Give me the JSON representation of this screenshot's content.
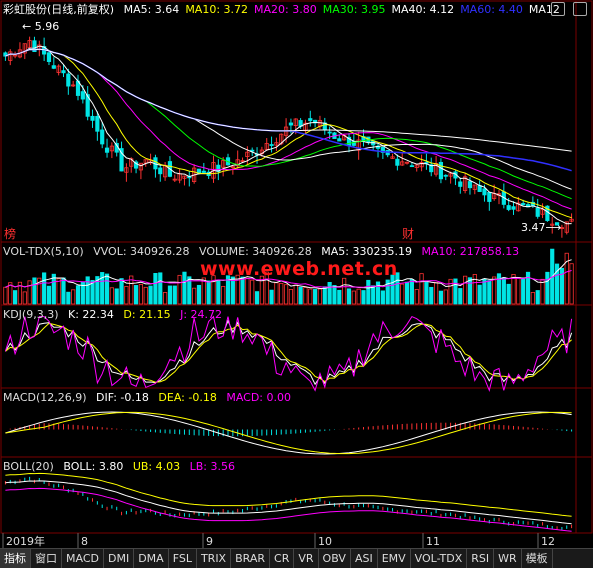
{
  "colors": {
    "bg": "#000000",
    "up": "#ff3232",
    "down": "#00e5e5",
    "grid": "#7a0000",
    "ma5": "#ffffff",
    "ma10": "#ffff00",
    "ma20": "#ff00ff",
    "ma30": "#00ff00",
    "ma40": "#ffffff",
    "ma60": "#3030ff",
    "ma120": "#ffffff"
  },
  "main": {
    "stock": "彩虹股份(日线,前复权)",
    "ma": [
      {
        "label": "MA5: 3.64",
        "color": "#ffffff"
      },
      {
        "label": "MA10: 3.72",
        "color": "#ffff00"
      },
      {
        "label": "MA20: 3.80",
        "color": "#ff00ff"
      },
      {
        "label": "MA30: 3.95",
        "color": "#00ff00"
      },
      {
        "label": "MA40: 4.12",
        "color": "#ffffff"
      },
      {
        "label": "MA60: 4.40",
        "color": "#3030ff"
      },
      {
        "label": "MA12",
        "color": "#ffffff"
      }
    ],
    "high_label": "5.96",
    "low_label": "3.47",
    "mark_bang": "榜",
    "mark_cai": "财"
  },
  "vol": {
    "name": "VOL-TDX(5,10)",
    "vvol": "VVOL: 340926.28",
    "volume": "VOLUME: 340926.28",
    "ma5": "MA5: 330235.19",
    "ma10": "MA10: 217858.13"
  },
  "watermark": "www.eweb.net.cn",
  "kdj": {
    "name": "KDJ(9,3,3)",
    "k": "K: 22.34",
    "d": "D: 21.15",
    "j": "J: 24.72"
  },
  "macd": {
    "name": "MACD(12,26,9)",
    "dif": "DIF: -0.18",
    "dea": "DEA: -0.18",
    "macd": "MACD: 0.00"
  },
  "boll": {
    "name": "BOLL(20)",
    "boll": "BOLL: 3.80",
    "ub": "UB: 4.03",
    "lb": "LB: 3.56"
  },
  "xaxis": {
    "labels": [
      "2019年",
      "8",
      "9",
      "10",
      "11",
      "12"
    ]
  },
  "tabs": [
    "指标",
    "窗口",
    "MACD",
    "DMI",
    "DMA",
    "FSL",
    "TRIX",
    "BRAR",
    "CR",
    "VR",
    "OBV",
    "ASI",
    "EMV",
    "VOL-TDX",
    "RSI",
    "WR",
    "模板"
  ],
  "chart_data": {
    "type": "candlestick",
    "title": "彩虹股份(日线,前复权)",
    "price_range": [
      3.47,
      5.96
    ],
    "annotations": [
      "5.96",
      "3.47"
    ],
    "months": [
      "2019年",
      "8",
      "9",
      "10",
      "11",
      "12"
    ],
    "close_approx": [
      5.6,
      5.8,
      5.5,
      5.2,
      4.6,
      4.2,
      4.3,
      4.1,
      4.15,
      4.2,
      4.3,
      4.5,
      4.7,
      4.8,
      4.6,
      4.5,
      4.35,
      4.3,
      4.2,
      4.1,
      3.9,
      3.8,
      3.7,
      3.6,
      3.5
    ],
    "indicators": {
      "MA": {
        "MA5": 3.64,
        "MA10": 3.72,
        "MA20": 3.8,
        "MA30": 3.95,
        "MA40": 4.12,
        "MA60": 4.4
      },
      "VOL": {
        "VVOL": 340926.28,
        "VOLUME": 340926.28,
        "MA5": 330235.19,
        "MA10": 217858.13
      },
      "KDJ": {
        "K": 22.34,
        "D": 21.15,
        "J": 24.72
      },
      "MACD": {
        "DIF": -0.18,
        "DEA": -0.18,
        "MACD": 0.0
      },
      "BOLL": {
        "BOLL": 3.8,
        "UB": 4.03,
        "LB": 3.56
      }
    }
  }
}
